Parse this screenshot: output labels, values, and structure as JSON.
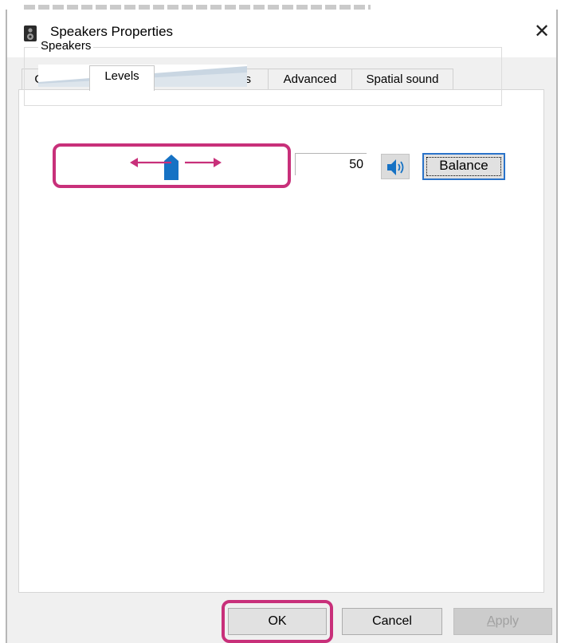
{
  "window": {
    "title": "Speakers Properties",
    "close_glyph": "✕"
  },
  "tabs": [
    {
      "label": "General",
      "active": false
    },
    {
      "label": "Levels",
      "active": true
    },
    {
      "label": "Enhancements",
      "active": false
    },
    {
      "label": "Advanced",
      "active": false
    },
    {
      "label": "Spatial sound",
      "active": false
    }
  ],
  "levels": {
    "group_label": "Speakers",
    "volume_value": "50",
    "slider_level": 0.5,
    "speaker_icon": "speaker-volume-icon",
    "balance_label": "Balance"
  },
  "buttons": {
    "ok": "OK",
    "cancel": "Cancel",
    "apply": "Apply"
  },
  "colors": {
    "accent": "#1672c4",
    "highlight": "#c8307a"
  }
}
